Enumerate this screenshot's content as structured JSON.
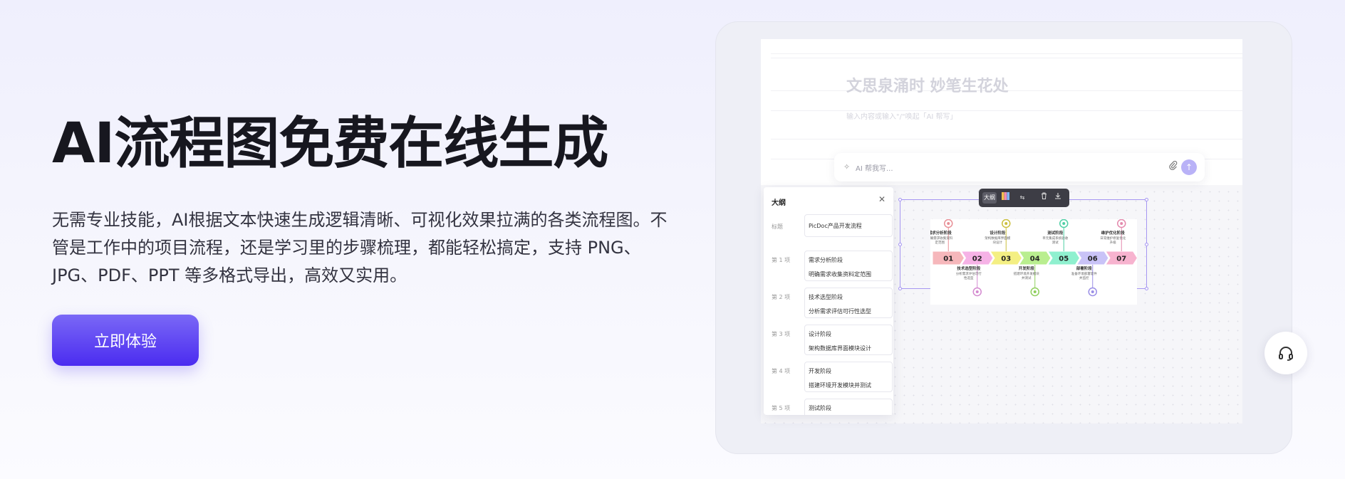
{
  "hero": {
    "title": "AI流程图免费在线生成",
    "description": "无需专业技能，AI根据文本快速生成逻辑清晰、可视化效果拉满的各类流程图。不管是工作中的项目流程，还是学习里的步骤梳理，都能轻松搞定，支持 PNG、JPG、PDF、PPT 等多格式导出，高效又实用。",
    "cta_label": "立即体验"
  },
  "editor": {
    "heading": "文思泉涌时 妙笔生花处",
    "hint": "输入内容或输入\"/\"唤起「AI 帮写」",
    "ai_placeholder": "AI 帮我写..."
  },
  "outline": {
    "title": "大纲",
    "title_label": "标题",
    "title_value": "PicDoc产品开发流程",
    "items": [
      {
        "label": "第 1 项",
        "name": "需求分析阶段",
        "desc": "明确需求收集资料定范围"
      },
      {
        "label": "第 2 项",
        "name": "技术选型阶段",
        "desc": "分析需求评估可行性选型"
      },
      {
        "label": "第 3 项",
        "name": "设计阶段",
        "desc": "架构数据库界面模块设计"
      },
      {
        "label": "第 4 项",
        "name": "开发阶段",
        "desc": "搭建环境开发模块并测试"
      },
      {
        "label": "第 5 项",
        "name": "测试阶段",
        "desc": ""
      }
    ]
  },
  "toolbar": {
    "outline_label": "大纲"
  },
  "flow": {
    "steps": [
      {
        "num": "01",
        "color": "#f6b7bb",
        "icon_color": "#e88f96"
      },
      {
        "num": "02",
        "color": "#f6b2e6",
        "icon_color": "#d48ad0"
      },
      {
        "num": "03",
        "color": "#f4ef83",
        "icon_color": "#cbbf3c"
      },
      {
        "num": "04",
        "color": "#b9ee8f",
        "icon_color": "#8fcf5c"
      },
      {
        "num": "05",
        "color": "#8ff0cf",
        "icon_color": "#4fcfa5"
      },
      {
        "num": "06",
        "color": "#c9c3f7",
        "icon_color": "#9a8ee6"
      },
      {
        "num": "07",
        "color": "#f7b3cf",
        "icon_color": "#e489ad"
      }
    ],
    "top_labels": [
      {
        "title": "需求分析阶段",
        "l1": "明确需求收集资料",
        "l2": "定范围"
      },
      {
        "title": "设计阶段",
        "l1": "架构数据库界面模",
        "l2": "块设计"
      },
      {
        "title": "测试阶段",
        "l1": "单元集成系统验收",
        "l2": "测试"
      },
      {
        "title": "维护优化阶段",
        "l1": "日常维护修复优化",
        "l2": "升级"
      }
    ],
    "bottom_labels": [
      {
        "title": "技术选型阶段",
        "l1": "分析需求评估可行",
        "l2": "性选型"
      },
      {
        "title": "开发阶段",
        "l1": "搭建环境开发模块",
        "l2": "并测试"
      },
      {
        "title": "部署阶段",
        "l1": "准备环境部署软件",
        "l2": "并监控"
      }
    ]
  }
}
